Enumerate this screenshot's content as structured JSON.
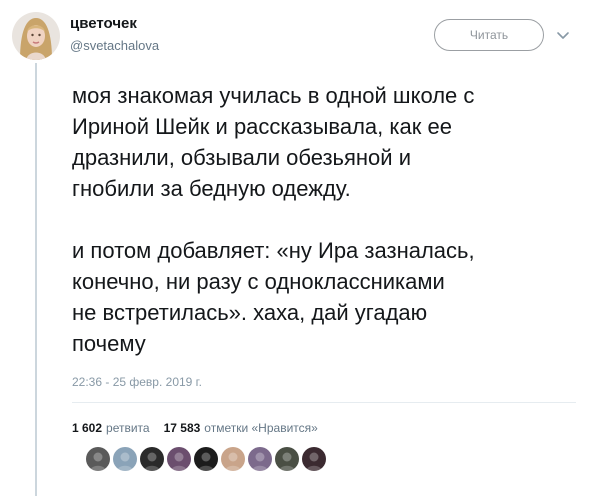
{
  "tweet": {
    "display_name": "цветочек",
    "handle": "@svetachalova",
    "follow_label": "Читать",
    "paragraphs": [
      "моя знакомая училась в одной школе с\nИриной Шейк и рассказывала, как ее\nдразнили, обзывали обезьяной и\nгнобили за бедную одежду.",
      "и потом добавляет: «ну Ира зазналась,\nконечно, ни разу с одноклассниками\nне встретилась». хаха, дай угадаю\nпочему"
    ],
    "timestamp": "22:36 - 25 февр. 2019 г.",
    "stats": {
      "retweets_count": "1 602",
      "retweets_label": "ретвита",
      "likes_count": "17 583",
      "likes_label": "отметки «Нравится»"
    },
    "likers": [
      {
        "name": "liker-avatar-1",
        "color": "#5a5a5a"
      },
      {
        "name": "liker-avatar-2",
        "color": "#8aa3b8"
      },
      {
        "name": "liker-avatar-3",
        "color": "#2a2a2a"
      },
      {
        "name": "liker-avatar-4",
        "color": "#6b4e6e"
      },
      {
        "name": "liker-avatar-5",
        "color": "#1c1c1c"
      },
      {
        "name": "liker-avatar-6",
        "color": "#c9a48a"
      },
      {
        "name": "liker-avatar-7",
        "color": "#7c6a8c"
      },
      {
        "name": "liker-avatar-8",
        "color": "#4a4f44"
      },
      {
        "name": "liker-avatar-9",
        "color": "#3b2a30"
      }
    ]
  },
  "colors": {
    "text_primary": "#14171a",
    "text_secondary": "#657786",
    "timestamp": "#8899a6",
    "border": "#e6ecf0",
    "thread_line": "#ccd6dd"
  }
}
